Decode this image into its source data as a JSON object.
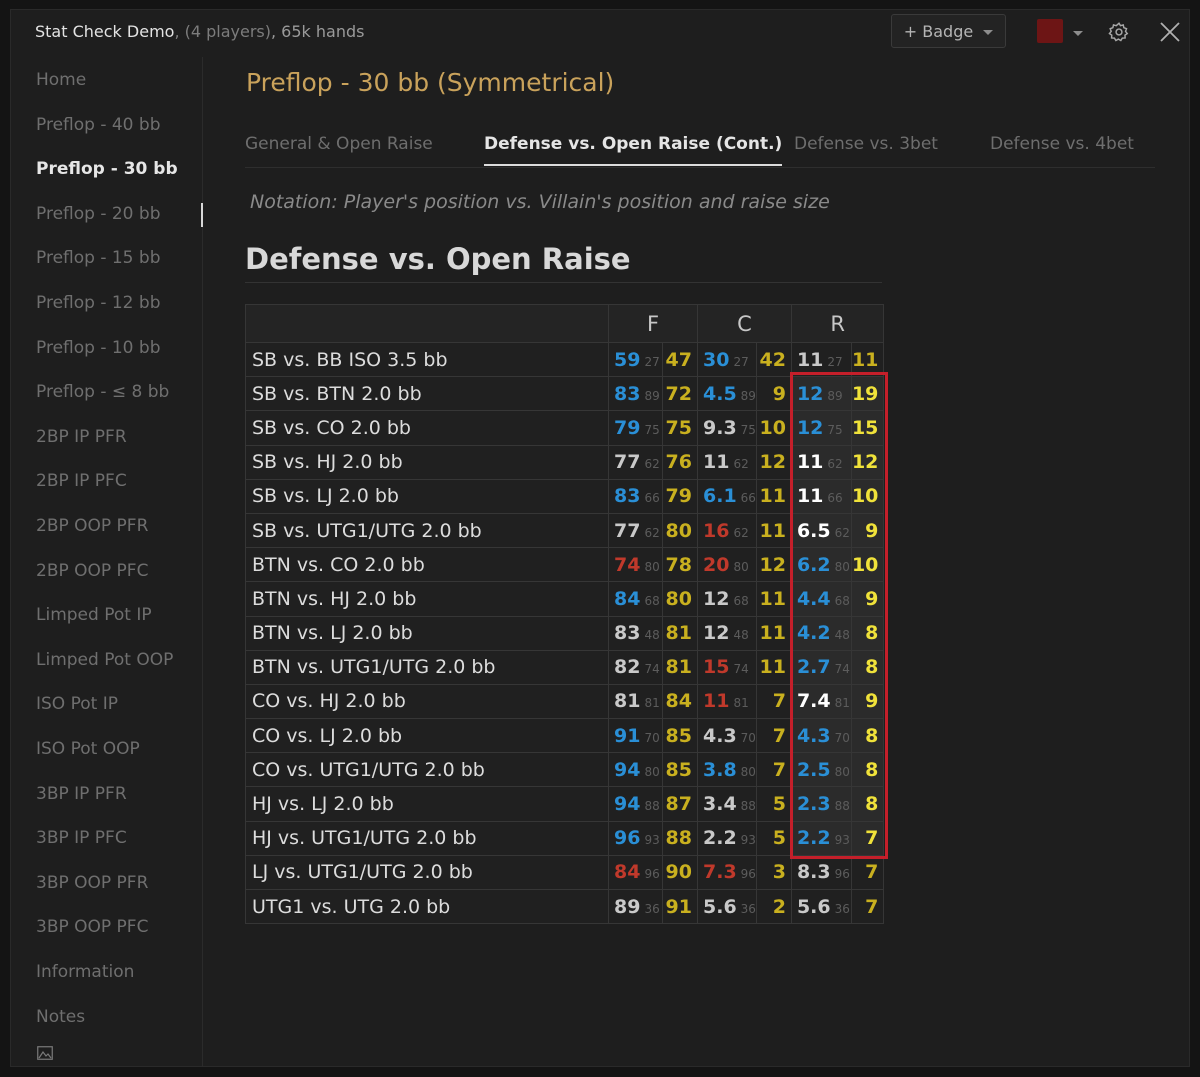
{
  "titlebar": {
    "name": "Stat Check Demo",
    "players": ", (4 players)",
    "hands": ", 65k hands",
    "badge_label": "+ Badge"
  },
  "colors": {
    "accent_title": "#c9a25b",
    "blue": "#2a8fd6",
    "olive": "#c9b01f",
    "red": "#c0392b",
    "white": "#ffffff",
    "yellow": "#f0e23a",
    "gray": "#c9c9c9",
    "highlight_border": "#c41f2a"
  },
  "sidebar": {
    "items": [
      {
        "label": "Home"
      },
      {
        "label": "Preflop - 40 bb"
      },
      {
        "label": "Preflop - 30 bb",
        "active": true
      },
      {
        "label": "Preflop - 20 bb"
      },
      {
        "label": "Preflop - 15 bb"
      },
      {
        "label": "Preflop - 12 bb"
      },
      {
        "label": "Preflop - 10 bb"
      },
      {
        "label": "Preflop - ≤ 8 bb"
      },
      {
        "label": "2BP IP PFR"
      },
      {
        "label": "2BP IP PFC"
      },
      {
        "label": "2BP OOP PFR"
      },
      {
        "label": "2BP OOP PFC"
      },
      {
        "label": "Limped Pot IP"
      },
      {
        "label": "Limped Pot OOP"
      },
      {
        "label": "ISO Pot IP"
      },
      {
        "label": "ISO Pot OOP"
      },
      {
        "label": "3BP IP PFR"
      },
      {
        "label": "3BP IP PFC"
      },
      {
        "label": "3BP OOP PFR"
      },
      {
        "label": "3BP OOP PFC"
      },
      {
        "label": "Information"
      },
      {
        "label": "Notes"
      }
    ]
  },
  "main": {
    "title": "Preflop - 30 bb (Symmetrical)",
    "tabs": [
      {
        "label": "General & Open Raise"
      },
      {
        "label": "Defense vs. Open Raise (Cont.)",
        "active": true
      },
      {
        "label": "Defense vs. 3bet"
      },
      {
        "label": "Defense vs. 4bet"
      }
    ],
    "notation": "Notation: Player's position vs. Villain's position and raise size",
    "section_title": "Defense vs. Open Raise"
  },
  "table": {
    "headers": [
      "F",
      "C",
      "R"
    ],
    "rows": [
      {
        "label": "SB vs. BB ISO 3.5 bb",
        "f": [
          "59",
          "27",
          "blue"
        ],
        "fa": [
          "47",
          "olive"
        ],
        "c": [
          "30",
          "27",
          "blue"
        ],
        "ca": [
          "42",
          "olive"
        ],
        "r": [
          "11",
          "27",
          "gray"
        ],
        "ra": [
          "11",
          "olive"
        ]
      },
      {
        "label": "SB vs. BTN 2.0 bb",
        "f": [
          "83",
          "89",
          "blue"
        ],
        "fa": [
          "72",
          "olive"
        ],
        "c": [
          "4.5",
          "89",
          "blue"
        ],
        "ca": [
          "9",
          "olive"
        ],
        "r": [
          "12",
          "89",
          "blue"
        ],
        "ra": [
          "19",
          "yellow"
        ]
      },
      {
        "label": "SB vs. CO 2.0 bb",
        "f": [
          "79",
          "75",
          "blue"
        ],
        "fa": [
          "75",
          "olive"
        ],
        "c": [
          "9.3",
          "75",
          "gray"
        ],
        "ca": [
          "10",
          "olive"
        ],
        "r": [
          "12",
          "75",
          "blue"
        ],
        "ra": [
          "15",
          "yellow"
        ]
      },
      {
        "label": "SB vs. HJ 2.0 bb",
        "f": [
          "77",
          "62",
          "gray"
        ],
        "fa": [
          "76",
          "olive"
        ],
        "c": [
          "11",
          "62",
          "gray"
        ],
        "ca": [
          "12",
          "olive"
        ],
        "r": [
          "11",
          "62",
          "white"
        ],
        "ra": [
          "12",
          "yellow"
        ]
      },
      {
        "label": "SB vs. LJ 2.0 bb",
        "f": [
          "83",
          "66",
          "blue"
        ],
        "fa": [
          "79",
          "olive"
        ],
        "c": [
          "6.1",
          "66",
          "blue"
        ],
        "ca": [
          "11",
          "olive"
        ],
        "r": [
          "11",
          "66",
          "white"
        ],
        "ra": [
          "10",
          "yellow"
        ]
      },
      {
        "label": "SB vs. UTG1/UTG 2.0 bb",
        "f": [
          "77",
          "62",
          "gray"
        ],
        "fa": [
          "80",
          "olive"
        ],
        "c": [
          "16",
          "62",
          "red"
        ],
        "ca": [
          "11",
          "olive"
        ],
        "r": [
          "6.5",
          "62",
          "white"
        ],
        "ra": [
          "9",
          "yellow"
        ]
      },
      {
        "label": "BTN vs. CO 2.0 bb",
        "f": [
          "74",
          "80",
          "red"
        ],
        "fa": [
          "78",
          "olive"
        ],
        "c": [
          "20",
          "80",
          "red"
        ],
        "ca": [
          "12",
          "olive"
        ],
        "r": [
          "6.2",
          "80",
          "blue"
        ],
        "ra": [
          "10",
          "yellow"
        ]
      },
      {
        "label": "BTN vs. HJ 2.0 bb",
        "f": [
          "84",
          "68",
          "blue"
        ],
        "fa": [
          "80",
          "olive"
        ],
        "c": [
          "12",
          "68",
          "gray"
        ],
        "ca": [
          "11",
          "olive"
        ],
        "r": [
          "4.4",
          "68",
          "blue"
        ],
        "ra": [
          "9",
          "yellow"
        ]
      },
      {
        "label": "BTN vs. LJ 2.0 bb",
        "f": [
          "83",
          "48",
          "gray"
        ],
        "fa": [
          "81",
          "olive"
        ],
        "c": [
          "12",
          "48",
          "gray"
        ],
        "ca": [
          "11",
          "olive"
        ],
        "r": [
          "4.2",
          "48",
          "blue"
        ],
        "ra": [
          "8",
          "yellow"
        ]
      },
      {
        "label": "BTN vs. UTG1/UTG 2.0 bb",
        "f": [
          "82",
          "74",
          "gray"
        ],
        "fa": [
          "81",
          "olive"
        ],
        "c": [
          "15",
          "74",
          "red"
        ],
        "ca": [
          "11",
          "olive"
        ],
        "r": [
          "2.7",
          "74",
          "blue"
        ],
        "ra": [
          "8",
          "yellow"
        ]
      },
      {
        "label": "CO vs. HJ 2.0 bb",
        "f": [
          "81",
          "81",
          "gray"
        ],
        "fa": [
          "84",
          "olive"
        ],
        "c": [
          "11",
          "81",
          "red"
        ],
        "ca": [
          "7",
          "olive"
        ],
        "r": [
          "7.4",
          "81",
          "white"
        ],
        "ra": [
          "9",
          "yellow"
        ]
      },
      {
        "label": "CO vs. LJ 2.0 bb",
        "f": [
          "91",
          "70",
          "blue"
        ],
        "fa": [
          "85",
          "olive"
        ],
        "c": [
          "4.3",
          "70",
          "gray"
        ],
        "ca": [
          "7",
          "olive"
        ],
        "r": [
          "4.3",
          "70",
          "blue"
        ],
        "ra": [
          "8",
          "yellow"
        ]
      },
      {
        "label": "CO vs. UTG1/UTG 2.0 bb",
        "f": [
          "94",
          "80",
          "blue"
        ],
        "fa": [
          "85",
          "olive"
        ],
        "c": [
          "3.8",
          "80",
          "blue"
        ],
        "ca": [
          "7",
          "olive"
        ],
        "r": [
          "2.5",
          "80",
          "blue"
        ],
        "ra": [
          "8",
          "yellow"
        ]
      },
      {
        "label": "HJ vs. LJ 2.0 bb",
        "f": [
          "94",
          "88",
          "blue"
        ],
        "fa": [
          "87",
          "olive"
        ],
        "c": [
          "3.4",
          "88",
          "gray"
        ],
        "ca": [
          "5",
          "olive"
        ],
        "r": [
          "2.3",
          "88",
          "blue"
        ],
        "ra": [
          "8",
          "yellow"
        ]
      },
      {
        "label": "HJ vs. UTG1/UTG 2.0 bb",
        "f": [
          "96",
          "93",
          "blue"
        ],
        "fa": [
          "88",
          "olive"
        ],
        "c": [
          "2.2",
          "93",
          "gray"
        ],
        "ca": [
          "5",
          "olive"
        ],
        "r": [
          "2.2",
          "93",
          "blue"
        ],
        "ra": [
          "7",
          "yellow"
        ]
      },
      {
        "label": "LJ vs. UTG1/UTG 2.0 bb",
        "f": [
          "84",
          "96",
          "red"
        ],
        "fa": [
          "90",
          "olive"
        ],
        "c": [
          "7.3",
          "96",
          "red"
        ],
        "ca": [
          "3",
          "olive"
        ],
        "r": [
          "8.3",
          "96",
          "gray"
        ],
        "ra": [
          "7",
          "olive"
        ]
      },
      {
        "label": "UTG1 vs. UTG 2.0 bb",
        "f": [
          "89",
          "36",
          "gray"
        ],
        "fa": [
          "91",
          "olive"
        ],
        "c": [
          "5.6",
          "36",
          "gray"
        ],
        "ca": [
          "2",
          "olive"
        ],
        "r": [
          "5.6",
          "36",
          "gray"
        ],
        "ra": [
          "7",
          "olive"
        ]
      }
    ]
  }
}
